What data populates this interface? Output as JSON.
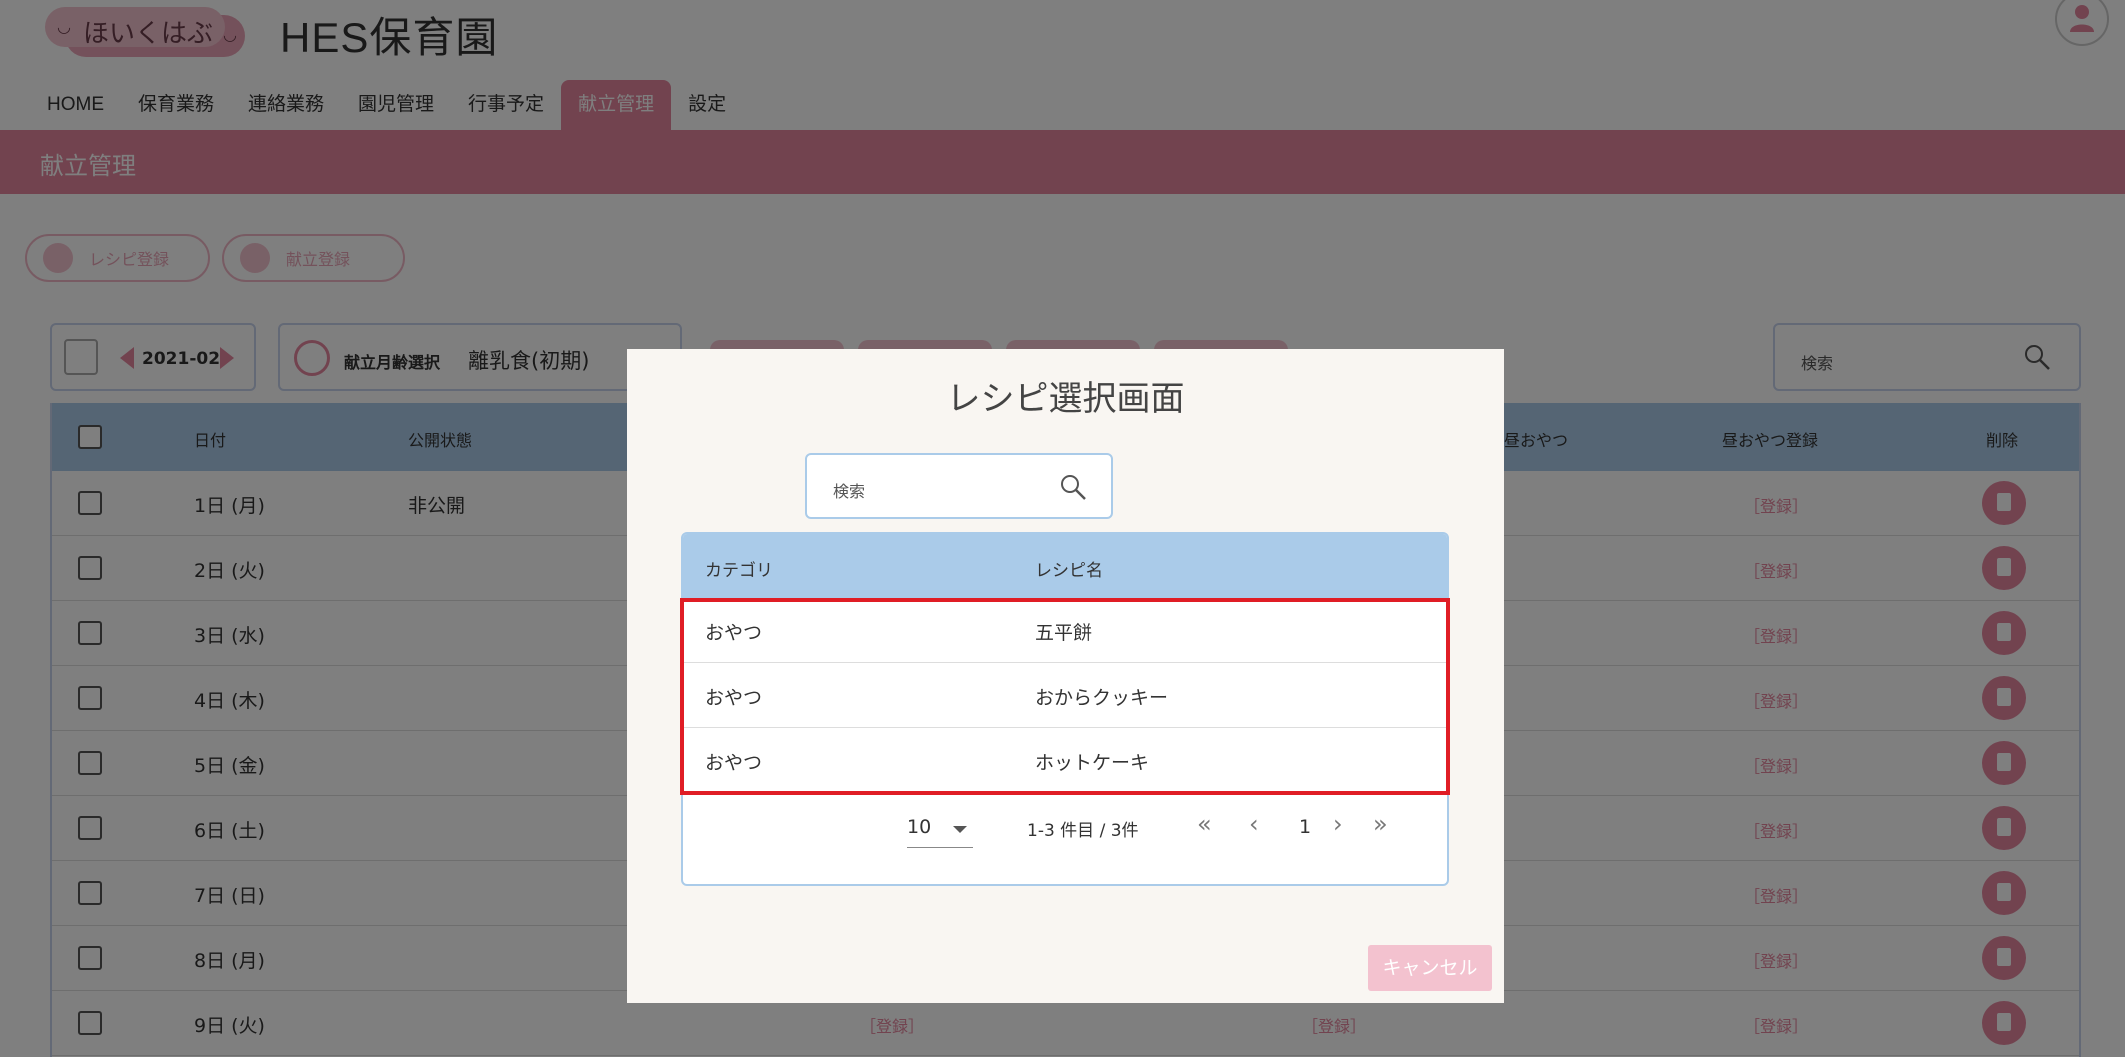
{
  "header": {
    "logo_text": "ほいくはぶ",
    "app_title": "HES保育園"
  },
  "nav": {
    "items": [
      {
        "label": "HOME"
      },
      {
        "label": "保育業務"
      },
      {
        "label": "連絡業務"
      },
      {
        "label": "園児管理"
      },
      {
        "label": "行事予定"
      },
      {
        "label": "献立管理",
        "active": true
      },
      {
        "label": "設定"
      }
    ]
  },
  "section": {
    "title": "献立管理"
  },
  "toolbar": {
    "recipe_register_label": "レシピ登録",
    "menu_register_label": "献立登録",
    "month": "2021-02",
    "age_select_label": "献立月齢選択",
    "age_select_value": "離乳食(初期)",
    "search_placeholder": "検索"
  },
  "bg_table": {
    "headers": {
      "date": "日付",
      "status": "公開状態",
      "afternoon_snack": "昼おやつ",
      "afternoon_snack_register": "昼おやつ登録",
      "delete": "削除"
    },
    "register_link": "［登録］",
    "rows": [
      {
        "date": "1日 (月)",
        "status": "非公開"
      },
      {
        "date": "2日 (火)",
        "status": ""
      },
      {
        "date": "3日 (水)",
        "status": ""
      },
      {
        "date": "4日 (木)",
        "status": ""
      },
      {
        "date": "5日 (金)",
        "status": ""
      },
      {
        "date": "6日 (土)",
        "status": ""
      },
      {
        "date": "7日 (日)",
        "status": ""
      },
      {
        "date": "8日 (月)",
        "status": ""
      },
      {
        "date": "9日 (火)",
        "status": ""
      }
    ]
  },
  "modal": {
    "title": "レシピ選択画面",
    "search_placeholder": "検索",
    "table": {
      "headers": {
        "category": "カテゴリ",
        "recipe_name": "レシピ名"
      },
      "rows": [
        {
          "category": "おやつ",
          "name": "五平餅"
        },
        {
          "category": "おやつ",
          "name": "おからクッキー"
        },
        {
          "category": "おやつ",
          "name": "ホットケーキ"
        }
      ]
    },
    "pagination": {
      "per_page": "10",
      "range": "1-3 件目 / 3件",
      "first": "«",
      "prev": "‹",
      "page": "1",
      "next": "›",
      "last": "»"
    },
    "cancel_label": "キャンセル"
  },
  "colors": {
    "accent_pink": "#e4869f",
    "header_blue": "#aacbe9",
    "highlight_red": "#e01d25"
  }
}
